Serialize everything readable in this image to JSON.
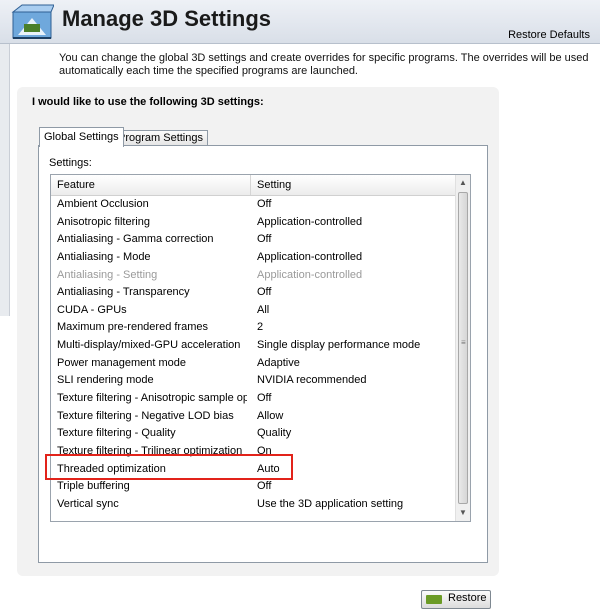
{
  "header": {
    "title": "Manage 3D Settings",
    "restore_defaults": "Restore Defaults",
    "logo_icon": "nvidia-control-panel-3d-icon"
  },
  "description": "You can change the global 3D settings and create overrides for specific programs. The overrides will be used automatically each time the specified programs are launched.",
  "section": {
    "title": "I would like to use the following 3D settings:",
    "tabs": [
      {
        "label": "Global Settings",
        "selected": true
      },
      {
        "label": "Program Settings",
        "selected": false
      }
    ],
    "settings_label": "Settings:",
    "columns": {
      "feature": "Feature",
      "setting": "Setting"
    },
    "rows": [
      {
        "feature": "Ambient Occlusion",
        "setting": "Off",
        "disabled": false
      },
      {
        "feature": "Anisotropic filtering",
        "setting": "Application-controlled",
        "disabled": false
      },
      {
        "feature": "Antialiasing - Gamma correction",
        "setting": "Off",
        "disabled": false
      },
      {
        "feature": "Antialiasing - Mode",
        "setting": "Application-controlled",
        "disabled": false
      },
      {
        "feature": "Antialiasing - Setting",
        "setting": "Application-controlled",
        "disabled": true
      },
      {
        "feature": "Antialiasing - Transparency",
        "setting": "Off",
        "disabled": false
      },
      {
        "feature": "CUDA - GPUs",
        "setting": "All",
        "disabled": false
      },
      {
        "feature": "Maximum pre-rendered frames",
        "setting": "2",
        "disabled": false
      },
      {
        "feature": "Multi-display/mixed-GPU acceleration",
        "setting": "Single display performance mode",
        "disabled": false
      },
      {
        "feature": "Power management mode",
        "setting": "Adaptive",
        "disabled": false
      },
      {
        "feature": "SLI rendering mode",
        "setting": "NVIDIA recommended",
        "disabled": false
      },
      {
        "feature": "Texture filtering - Anisotropic sample opti...",
        "setting": "Off",
        "disabled": false
      },
      {
        "feature": "Texture filtering - Negative LOD bias",
        "setting": "Allow",
        "disabled": false
      },
      {
        "feature": "Texture filtering - Quality",
        "setting": "Quality",
        "disabled": false
      },
      {
        "feature": "Texture filtering - Trilinear optimization",
        "setting": "On",
        "disabled": false
      },
      {
        "feature": "Threaded optimization",
        "setting": "Auto",
        "disabled": false
      },
      {
        "feature": "Triple buffering",
        "setting": "Off",
        "disabled": false
      },
      {
        "feature": "Vertical sync",
        "setting": "Use the 3D application setting",
        "disabled": false
      }
    ],
    "restore_button": "Restore"
  },
  "colors": {
    "highlight_border": "#e2231a",
    "nvidia_green": "#6b9b26"
  }
}
